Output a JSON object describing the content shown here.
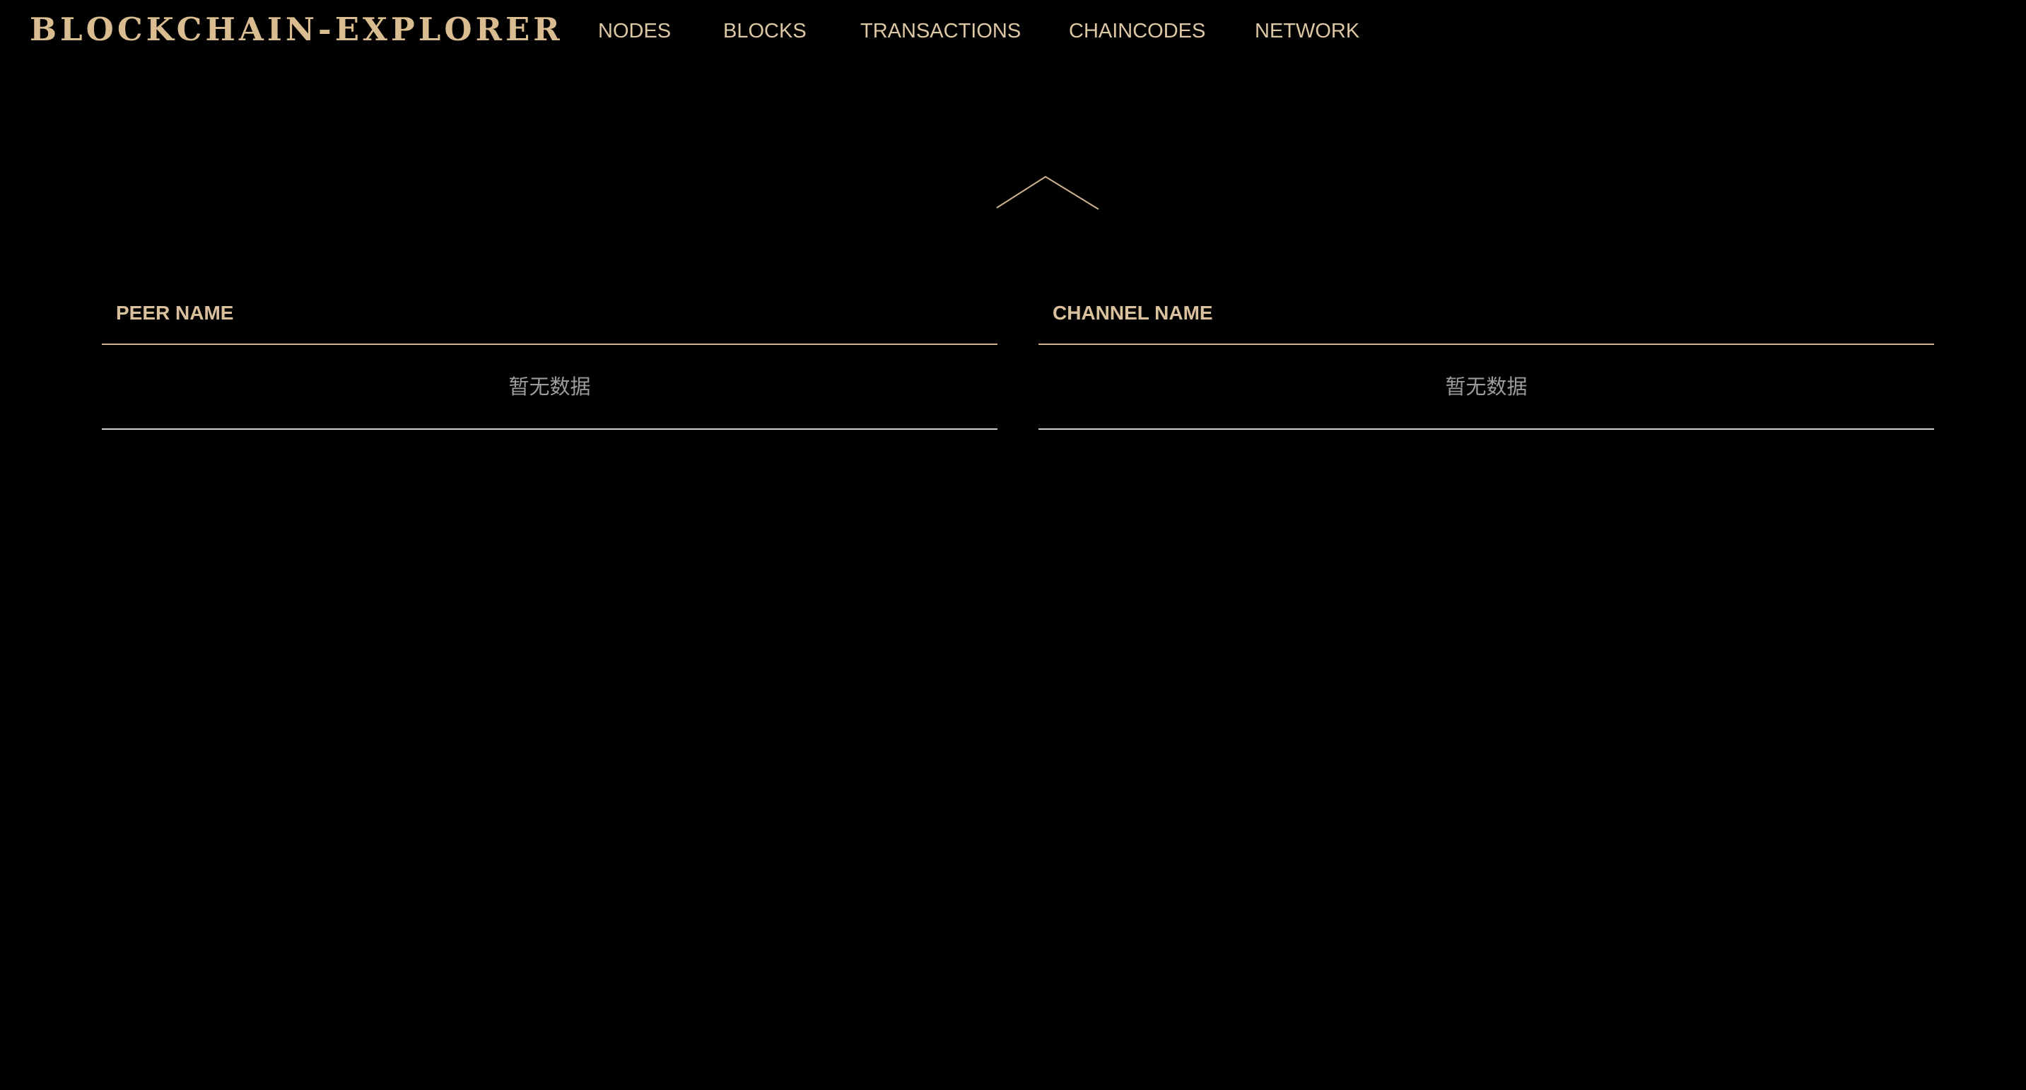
{
  "app": {
    "brand": "BLOCKCHAIN-EXPLORER"
  },
  "nav": {
    "items": [
      {
        "label": "NODES"
      },
      {
        "label": "BLOCKS"
      },
      {
        "label": "TRANSACTIONS"
      },
      {
        "label": "CHAINCODES"
      },
      {
        "label": "NETWORK"
      }
    ]
  },
  "toggle": {
    "icon": "chevron-up-icon",
    "color": "#cdb38f"
  },
  "tables": {
    "peers": {
      "header": "PEER NAME",
      "empty_text": "暂无数据"
    },
    "channels": {
      "header": "CHANNEL NAME",
      "empty_text": "暂无数据"
    }
  },
  "colors": {
    "background": "#000000",
    "accent": "#d9bd90",
    "muted_text": "#9b9b9b"
  }
}
